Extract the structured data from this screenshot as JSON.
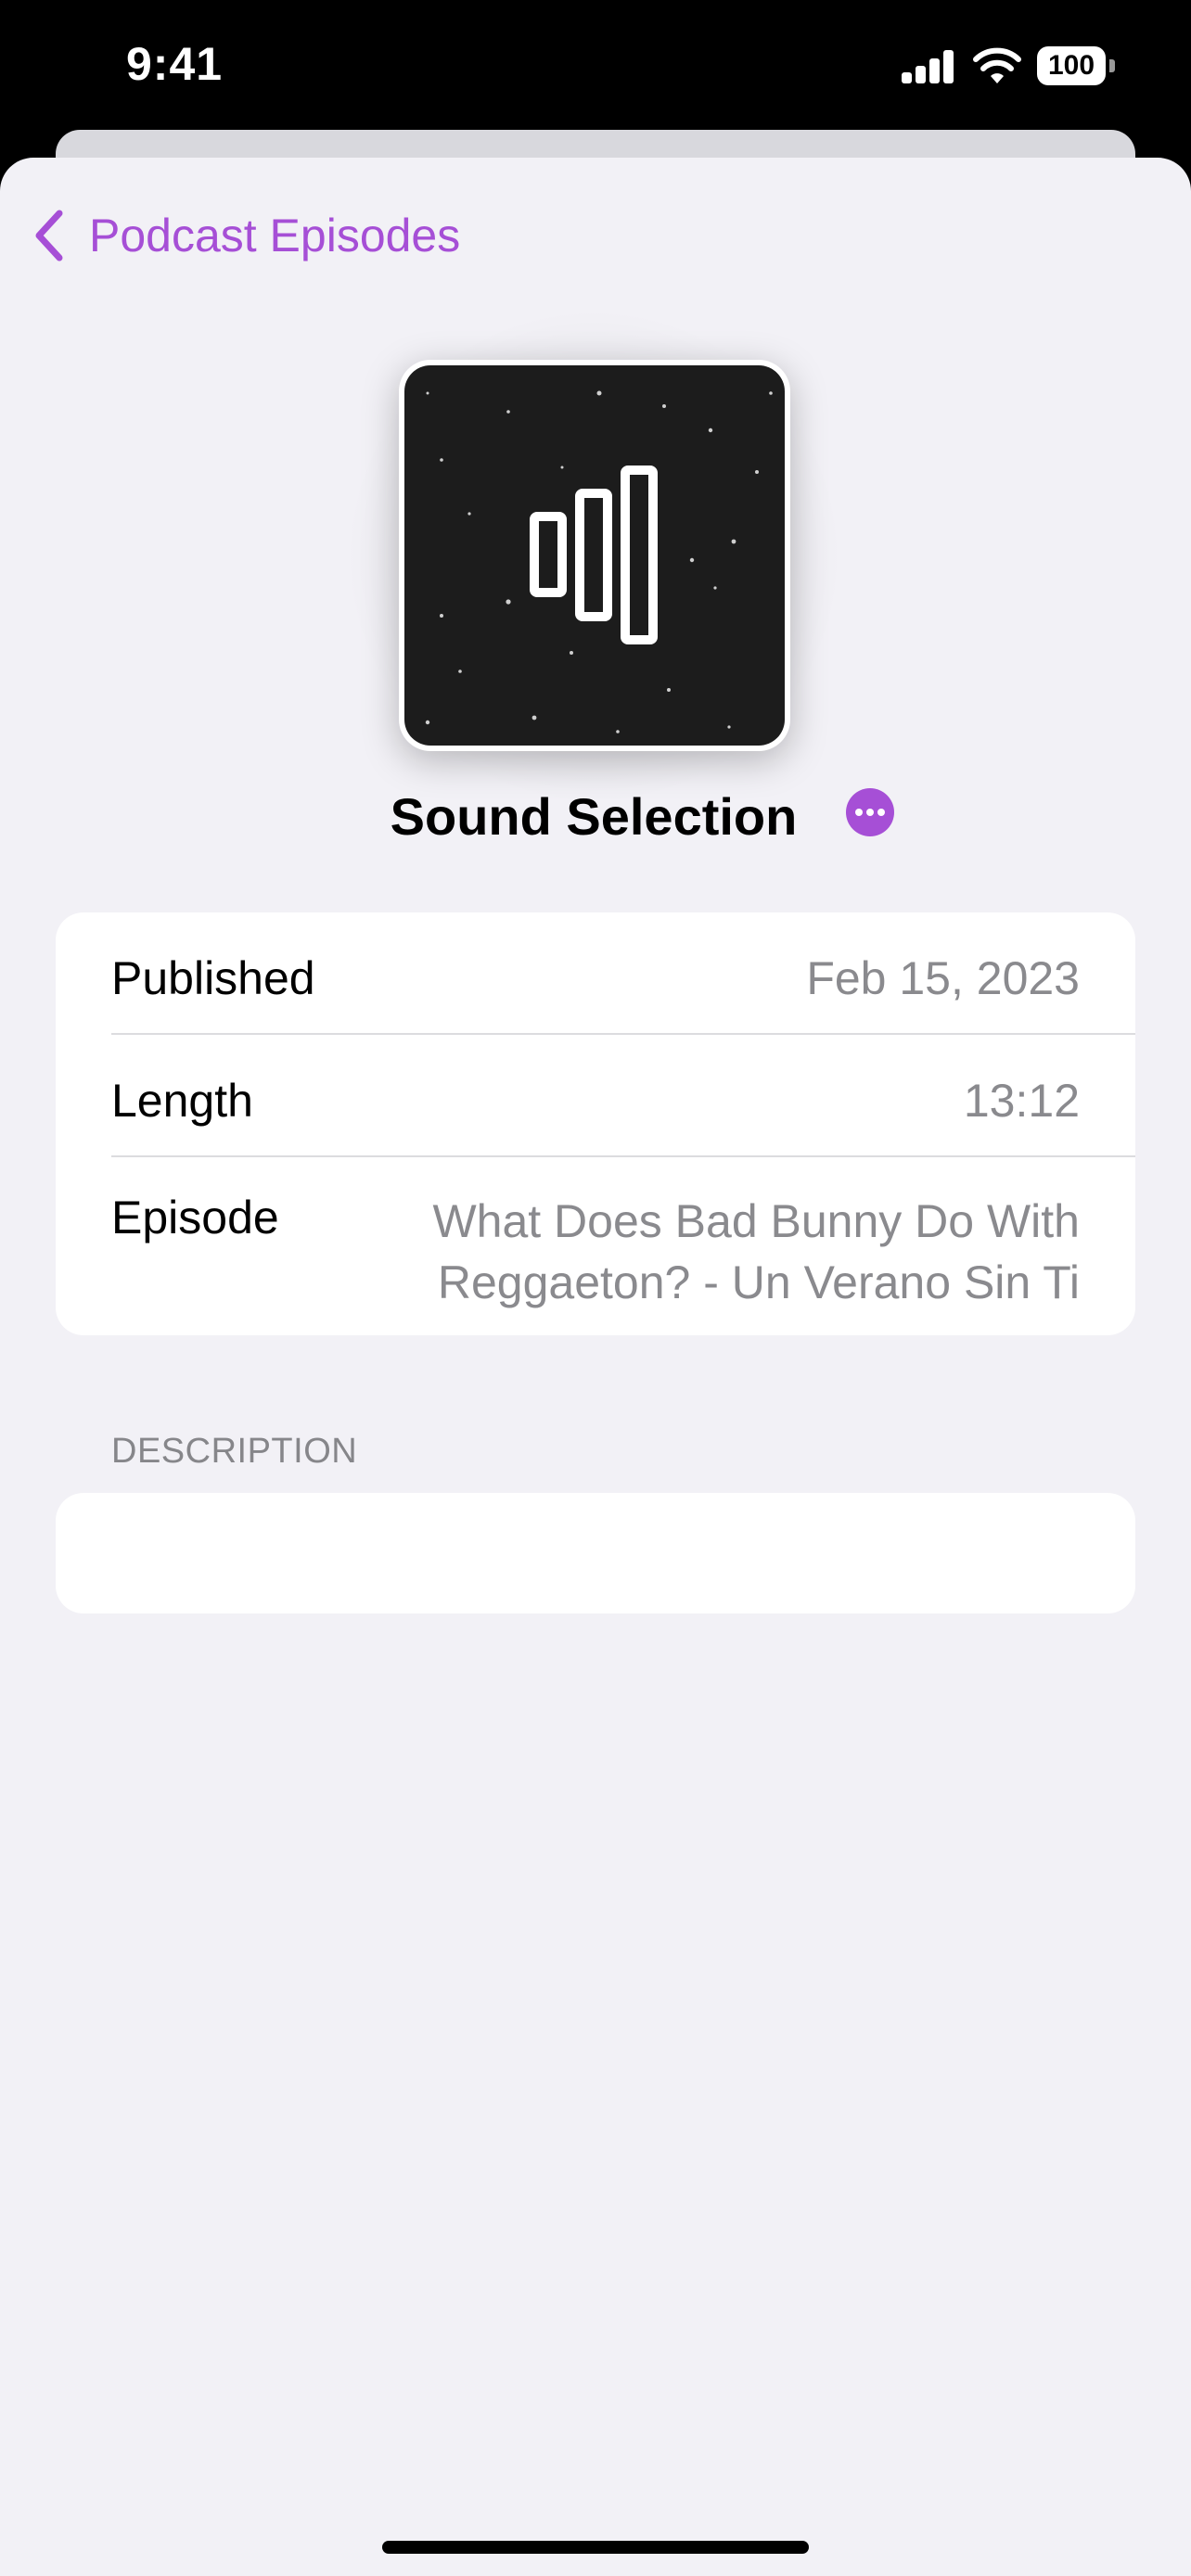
{
  "status_bar": {
    "time": "9:41",
    "battery": "100"
  },
  "nav": {
    "back_label": "Podcast Episodes"
  },
  "podcast": {
    "title": "Sound Selection"
  },
  "details": {
    "published_label": "Published",
    "published_value": "Feb 15, 2023",
    "length_label": "Length",
    "length_value": "13:12",
    "episode_label": "Episode",
    "episode_value": "What Does Bad Bunny Do With Reggaeton? - Un Verano Sin Ti"
  },
  "description": {
    "header": "DESCRIPTION",
    "text": ""
  },
  "colors": {
    "accent": "#a64fd6",
    "background": "#f2f1f6",
    "secondary_text": "#8a8a8e"
  },
  "icons": {
    "back": "chevron-left-icon",
    "more": "ellipsis-circle-icon",
    "signal": "cellular-signal-icon",
    "wifi": "wifi-icon",
    "battery": "battery-icon"
  }
}
